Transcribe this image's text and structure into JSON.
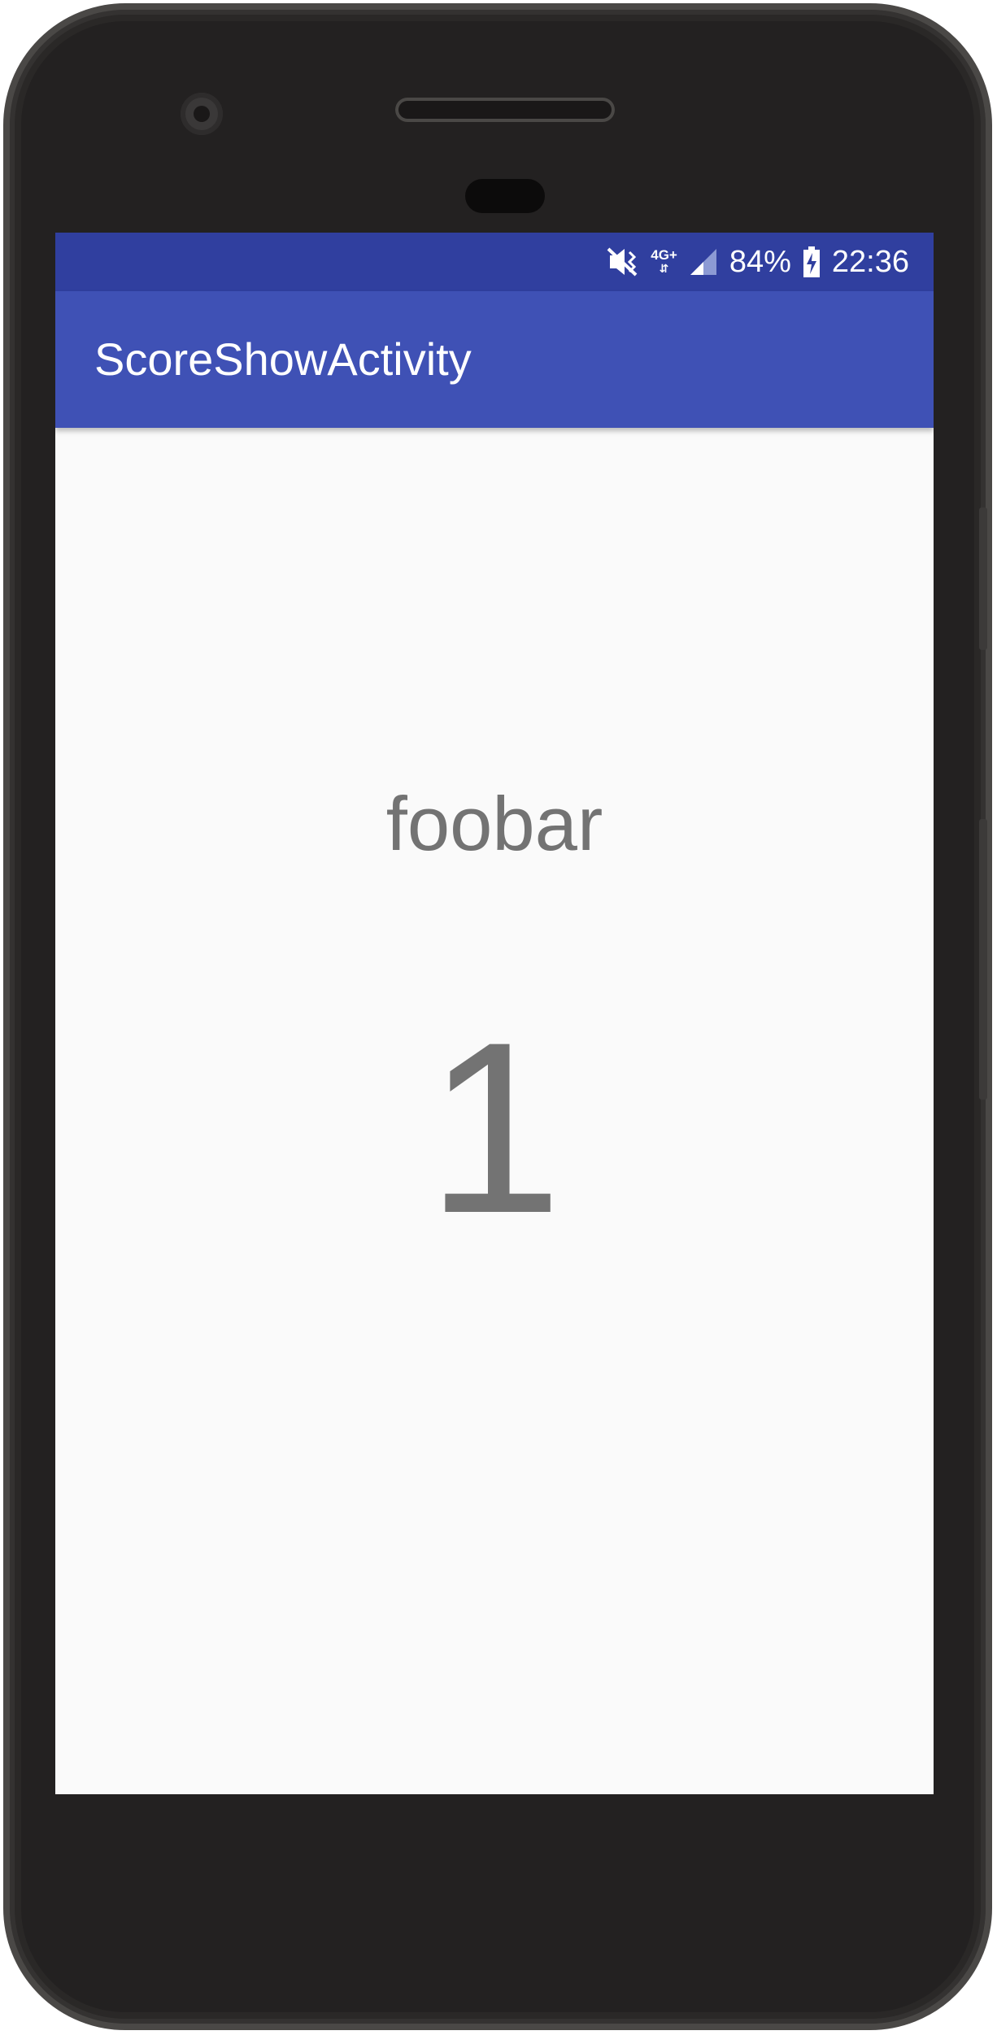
{
  "status_bar": {
    "network": "4G+",
    "battery": "84%",
    "time": "22:36",
    "icons": [
      "vibrate-mute-icon",
      "network-data-icon",
      "cell-signal-icon",
      "battery-charging-icon"
    ]
  },
  "app_bar": {
    "title": "ScoreShowActivity"
  },
  "content": {
    "name": "foobar",
    "score": "1"
  },
  "colors": {
    "status_bar": "#303f9f",
    "app_bar": "#3f51b5",
    "background": "#fafafa",
    "text": "#737373"
  }
}
